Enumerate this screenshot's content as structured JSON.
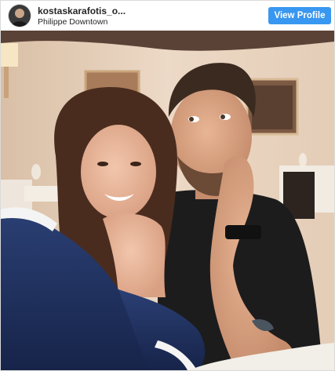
{
  "header": {
    "username": "kostaskarafotis_o...",
    "location": "Philippe Downtown",
    "view_profile_label": "View Profile",
    "button_color": "#3897f0"
  },
  "post": {
    "photo": {
      "icon": "photo-image",
      "colors": {
        "wall": "#e8d3be",
        "ceiling": "#5a4236",
        "tablecloth": "#f2eee8",
        "jacket": "#1e2f58",
        "shirt": "#1d1c1d"
      }
    }
  }
}
